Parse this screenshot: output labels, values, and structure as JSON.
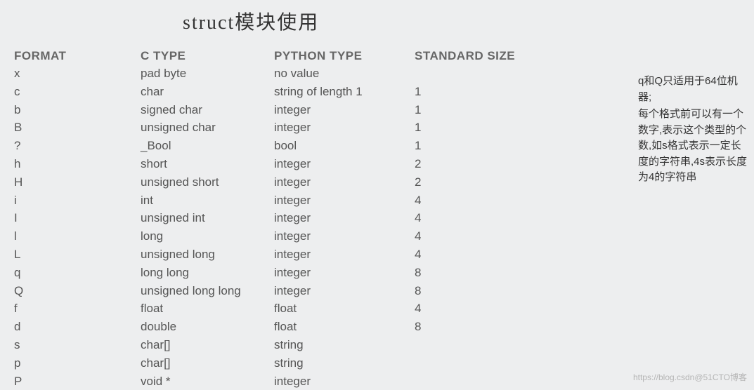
{
  "title": "struct模块使用",
  "headers": {
    "format": "FORMAT",
    "ctype": "C TYPE",
    "ptype": "PYTHON TYPE",
    "size": "STANDARD SIZE"
  },
  "rows": [
    {
      "format": "x",
      "ctype": "pad byte",
      "ptype": "no value",
      "size": ""
    },
    {
      "format": "c",
      "ctype": "char",
      "ptype": "string of length 1",
      "size": "1"
    },
    {
      "format": "b",
      "ctype": "signed char",
      "ptype": "integer",
      "size": "1"
    },
    {
      "format": "B",
      "ctype": "unsigned char",
      "ptype": "integer",
      "size": "1"
    },
    {
      "format": "?",
      "ctype": "_Bool",
      "ptype": "bool",
      "size": "1"
    },
    {
      "format": "h",
      "ctype": "short",
      "ptype": "integer",
      "size": "2"
    },
    {
      "format": "H",
      "ctype": "unsigned short",
      "ptype": "integer",
      "size": "2"
    },
    {
      "format": "i",
      "ctype": "int",
      "ptype": "integer",
      "size": "4"
    },
    {
      "format": "I",
      "ctype": "unsigned int",
      "ptype": "integer",
      "size": "4"
    },
    {
      "format": "l",
      "ctype": "long",
      "ptype": "integer",
      "size": "4"
    },
    {
      "format": "L",
      "ctype": "unsigned long",
      "ptype": "integer",
      "size": "4"
    },
    {
      "format": "q",
      "ctype": "long long",
      "ptype": "integer",
      "size": "8"
    },
    {
      "format": "Q",
      "ctype": "unsigned long long",
      "ptype": "integer",
      "size": "8"
    },
    {
      "format": "f",
      "ctype": "float",
      "ptype": "float",
      "size": "4"
    },
    {
      "format": "d",
      "ctype": "double",
      "ptype": "float",
      "size": "8"
    },
    {
      "format": "s",
      "ctype": "char[]",
      "ptype": "string",
      "size": ""
    },
    {
      "format": "p",
      "ctype": "char[]",
      "ptype": "string",
      "size": ""
    },
    {
      "format": "P",
      "ctype": "void *",
      "ptype": "integer",
      "size": ""
    }
  ],
  "sidebar": {
    "note1": "q和Q只适用于64位机器;",
    "note2": "每个格式前可以有一个数字,表示这个类型的个数,如s格式表示一定长度的字符串,4s表示长度为4的字符串"
  },
  "watermark": "https://blog.csdn@51CTO博客"
}
